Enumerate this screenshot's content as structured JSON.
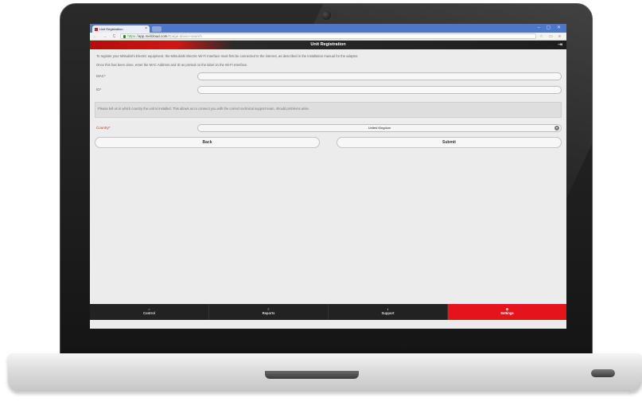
{
  "browser": {
    "tab_title": "Unit Registration",
    "tab_close": "×",
    "window_controls": "– ▢ ✕",
    "nav_buttons": "← → C",
    "url_scheme": "https://",
    "url_host": "app.melcloud.com",
    "url_path": "/#page-device-search",
    "right_icons": "☆ ▭ ≡"
  },
  "header": {
    "title": "Unit Registration"
  },
  "intro": {
    "line1": "To register your Mitsubishi Electric equipment, the Mitsubishi Electric Wi-Fi Interface must first be connected to the internet, as described in the installation manual for the adaptor.",
    "line2": "Once this has been done, enter the MAC Address and ID as printed on the label on the Wi-Fi Interface."
  },
  "form": {
    "mac_label": "MAC*",
    "mac_value": "",
    "id_label": "ID*",
    "id_value": "",
    "notice": "Please tell us in which country the unit is installed. This allows us to connect you with the correct technical support team, should problems arise.",
    "country_label": "Country*",
    "country_value": "United Kingdom"
  },
  "buttons": {
    "back": "Back",
    "submit": "Submit"
  },
  "bottom_nav": [
    {
      "label": "Control",
      "icon": "home-icon",
      "glyph": "⌂",
      "active": false
    },
    {
      "label": "Reports",
      "icon": "reports-icon",
      "glyph": "≡",
      "active": false
    },
    {
      "label": "Support",
      "icon": "info-icon",
      "glyph": "i",
      "active": false
    },
    {
      "label": "Settings",
      "icon": "gear-icon",
      "glyph": "⚙",
      "active": true
    }
  ],
  "colors": {
    "accent_red": "#e3141b",
    "browser_blue": "#4e77c7",
    "header_dark": "#1e1e1e"
  }
}
